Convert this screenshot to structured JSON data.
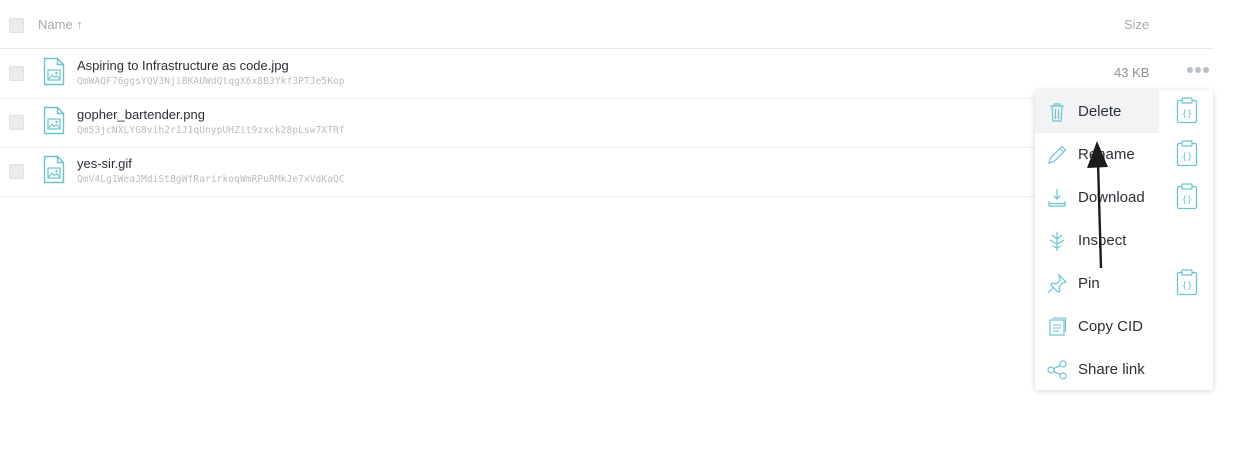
{
  "header": {
    "name_label": "Name ↑",
    "size_label": "Size"
  },
  "files": [
    {
      "name": "Aspiring to Infrastructure as code.jpg",
      "cid": "QmWAQF76ggsYQV3NjiBKAUWdQtqgX6x8B3Ykf3PTJe5Kop",
      "size": "43 KB",
      "icon": "image-file-icon"
    },
    {
      "name": "gopher_bartender.png",
      "cid": "Qm53jcNXLYG8vih2r1J1qUnypUHZit9zxck28pLsw7XTRf",
      "size": "",
      "icon": "image-file-icon"
    },
    {
      "name": "yes-sir.gif",
      "cid": "QmV4Lg1WeaJMdiSt8gWfRarirkoqWmRPuRMkJe7xVdKaQC",
      "size": "",
      "icon": "image-file-icon"
    }
  ],
  "context_menu": {
    "items": [
      {
        "label": "Delete",
        "icon": "trash-icon",
        "has_ipld_button": true
      },
      {
        "label": "Rename",
        "icon": "pencil-icon",
        "has_ipld_button": true
      },
      {
        "label": "Download",
        "icon": "download-icon",
        "has_ipld_button": true
      },
      {
        "label": "Inspect",
        "icon": "tree-icon",
        "has_ipld_button": false
      },
      {
        "label": "Pin",
        "icon": "pin-icon",
        "has_ipld_button": true
      },
      {
        "label": "Copy CID",
        "icon": "copy-icon",
        "has_ipld_button": false
      },
      {
        "label": "Share link",
        "icon": "share-icon",
        "has_ipld_button": false
      }
    ]
  },
  "colors": {
    "accent": "#69c4cd",
    "text": "#2b2f36",
    "muted": "#a4aab2"
  }
}
